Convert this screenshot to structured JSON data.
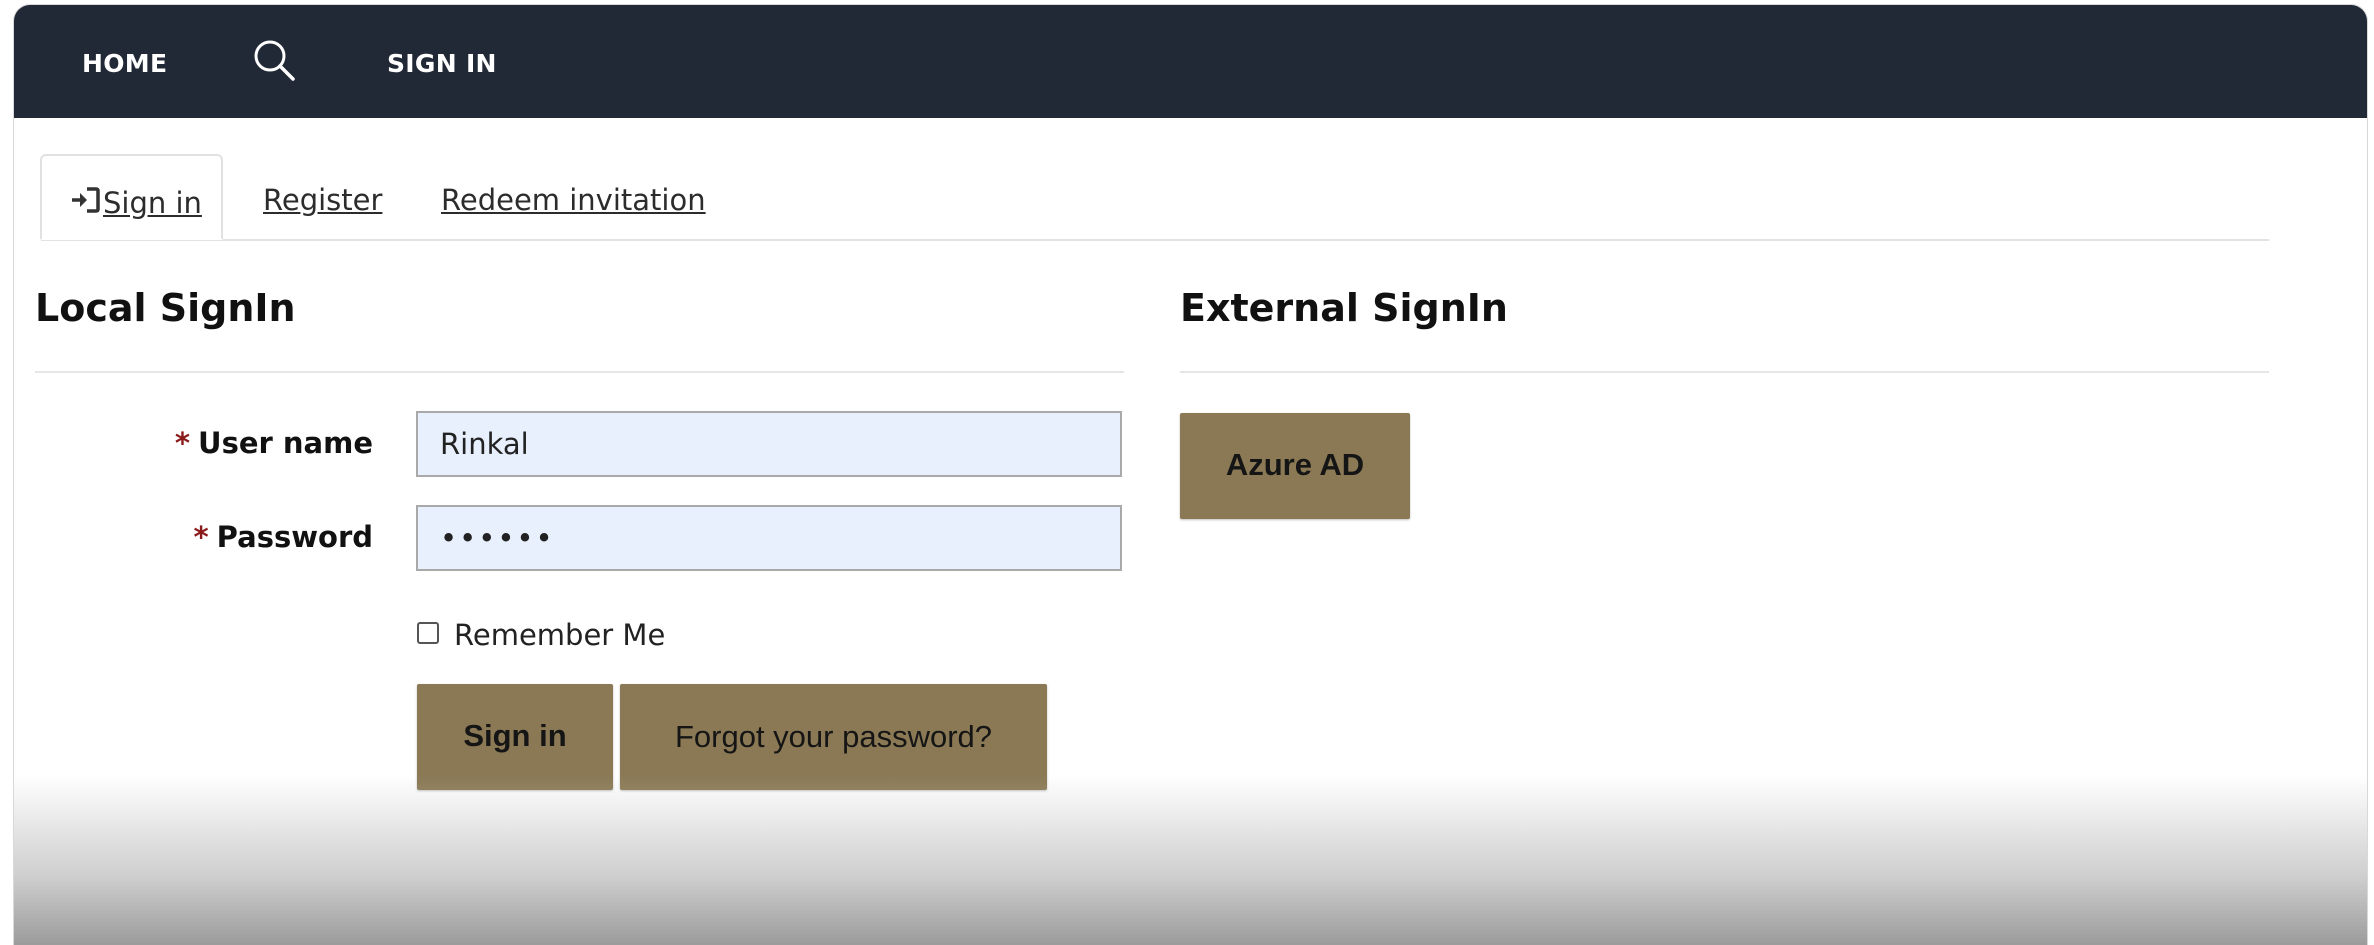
{
  "navbar": {
    "home_label": "HOME",
    "search_icon": "search-icon",
    "signin_label": "SIGN IN",
    "background": "#222936"
  },
  "tabs": [
    {
      "label": "Sign in",
      "icon": "sign-in-icon",
      "active": true
    },
    {
      "label": "Register",
      "active": false
    },
    {
      "label": "Redeem invitation",
      "active": false
    }
  ],
  "local_signin": {
    "title": "Local SignIn",
    "required_marker": "*",
    "username": {
      "label": "User name",
      "value": "Rinkal"
    },
    "password": {
      "label": "Password",
      "value": "••••••"
    },
    "remember_me": {
      "label": "Remember Me",
      "checked": false
    },
    "signin_button": "Sign in",
    "forgot_button": "Forgot your password?"
  },
  "external_signin": {
    "title": "External SignIn",
    "azure_button": "Azure AD"
  },
  "colors": {
    "button": "#8a7954",
    "input_bg": "#e8f0fe",
    "required": "#8b1a1a"
  }
}
